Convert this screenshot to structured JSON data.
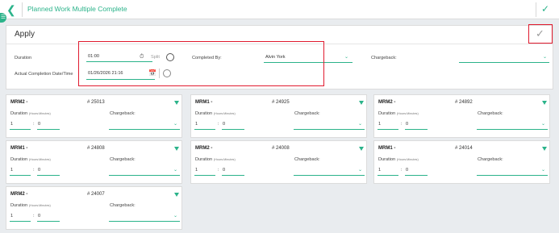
{
  "header": {
    "title": "Planned Work Multiple Complete"
  },
  "apply": {
    "title": "Apply",
    "duration_label": "Duration",
    "duration_value": "01:00",
    "split_label": "Split",
    "completed_by_label": "Completed By:",
    "completed_by_value": "Alvin York",
    "chargeback_label": "Chargeback:",
    "actual_completion_label": "Actual Completion Date/Time",
    "actual_completion_value": "01/26/2026 21:16"
  },
  "card_labels": {
    "duration": "Duration",
    "hours_minutes": "(Hours:Minutes)",
    "chargeback": "Chargeback:",
    "colon": ":"
  },
  "cards": [
    {
      "name": "MRM2 -",
      "number": "# 25013",
      "hours": "1",
      "minutes": "0"
    },
    {
      "name": "MRM1 -",
      "number": "# 24925",
      "hours": "1",
      "minutes": "0"
    },
    {
      "name": "MRM2 -",
      "number": "# 24892",
      "hours": "1",
      "minutes": "0"
    },
    {
      "name": "MRM1 -",
      "number": "# 24808",
      "hours": "1",
      "minutes": "0"
    },
    {
      "name": "MRM2 -",
      "number": "# 24008",
      "hours": "1",
      "minutes": "0"
    },
    {
      "name": "MRM1 -",
      "number": "# 24014",
      "hours": "1",
      "minutes": "0"
    },
    {
      "name": "MRM2 -",
      "number": "# 24007",
      "hours": "1",
      "minutes": "0"
    }
  ]
}
